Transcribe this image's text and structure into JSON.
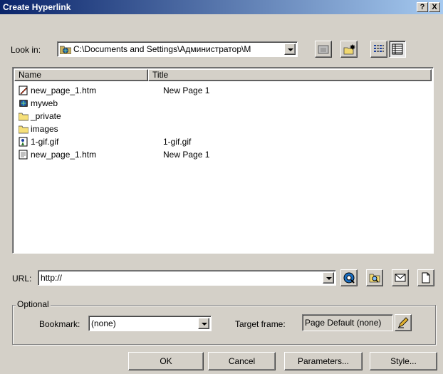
{
  "window": {
    "title": "Create Hyperlink",
    "help_glyph": "?",
    "close_glyph": "X"
  },
  "look_in": {
    "label": "Look in:",
    "path": "C:\\Documents and Settings\\Администратор\\M"
  },
  "toolbar_icons": [
    "folder-up-icon",
    "new-folder-icon",
    "list-view-icon",
    "details-view-icon"
  ],
  "file_list": {
    "columns": {
      "name": "Name",
      "title": "Title"
    },
    "rows": [
      {
        "icon": "html-file-icon",
        "name": "new_page_1.htm",
        "title": "New Page 1"
      },
      {
        "icon": "web-folder-icon",
        "name": "myweb",
        "title": ""
      },
      {
        "icon": "folder-icon",
        "name": "_private",
        "title": ""
      },
      {
        "icon": "folder-icon",
        "name": "images",
        "title": ""
      },
      {
        "icon": "gif-file-icon",
        "name": "1-gif.gif",
        "title": "1-gif.gif"
      },
      {
        "icon": "text-file-icon",
        "name": "new_page_1.htm",
        "title": "New Page 1"
      }
    ]
  },
  "url": {
    "label": "URL:",
    "value": "http://"
  },
  "url_icons": [
    "browse-web-icon",
    "browse-file-icon",
    "email-icon",
    "new-page-icon"
  ],
  "optional": {
    "legend": "Optional",
    "bookmark_label": "Bookmark:",
    "bookmark_value": "(none)",
    "target_label": "Target frame:",
    "target_value": "Page Default (none)"
  },
  "buttons": {
    "ok": "OK",
    "cancel": "Cancel",
    "parameters": "Parameters...",
    "style": "Style..."
  }
}
